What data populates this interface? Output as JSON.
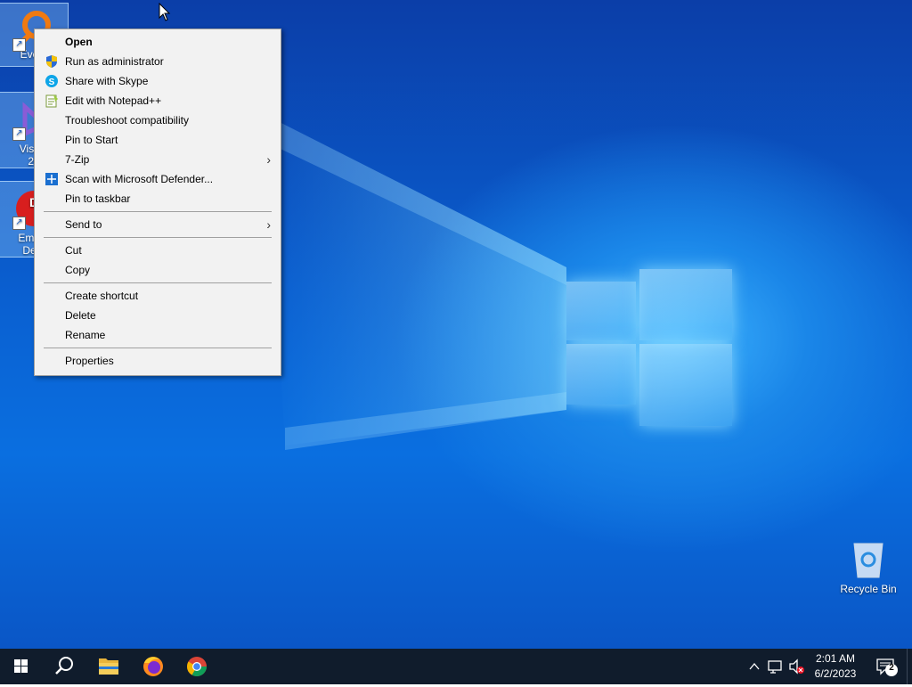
{
  "desktop": {
    "icons": [
      {
        "label": "Every",
        "name": "desktop-icon-everything"
      },
      {
        "label": "Visual",
        "label2": "20",
        "name": "desktop-icon-visual-studio"
      },
      {
        "label": "Embar",
        "label2": "Dev-",
        "name": "desktop-icon-embarcadero"
      },
      {
        "label": "Recycle Bin",
        "name": "desktop-icon-recycle-bin"
      }
    ]
  },
  "context_menu": {
    "items": [
      {
        "label": "Open",
        "bold": true
      },
      {
        "label": "Run as administrator",
        "icon": "shield-icon"
      },
      {
        "label": "Share with Skype",
        "icon": "skype-icon"
      },
      {
        "label": "Edit with Notepad++",
        "icon": "notepad-plus-plus-icon"
      },
      {
        "label": "Troubleshoot compatibility"
      },
      {
        "label": "Pin to Start"
      },
      {
        "label": "7-Zip",
        "submenu": true
      },
      {
        "label": "Scan with Microsoft Defender...",
        "icon": "defender-icon"
      },
      {
        "label": "Pin to taskbar"
      },
      {
        "label": "Send to",
        "submenu": true
      },
      {
        "label": "Cut"
      },
      {
        "label": "Copy"
      },
      {
        "label": "Create shortcut"
      },
      {
        "label": "Delete"
      },
      {
        "label": "Rename"
      },
      {
        "label": "Properties"
      }
    ]
  },
  "taskbar": {
    "buttons": [
      "start-icon",
      "search-icon",
      "file-explorer-icon",
      "firefox-icon",
      "chrome-icon"
    ],
    "tray": {
      "time": "2:01 AM",
      "date": "6/2/2023",
      "notification_count": "2"
    }
  }
}
